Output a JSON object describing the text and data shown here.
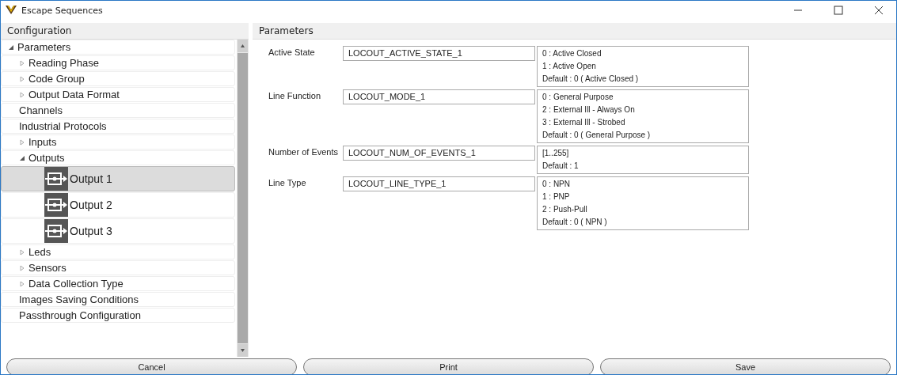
{
  "window": {
    "title": "Escape Sequences"
  },
  "sidebar": {
    "header": "Configuration",
    "tree": [
      {
        "label": "Parameters",
        "expanded": true,
        "children": [
          {
            "label": "Reading Phase",
            "expanded": false
          },
          {
            "label": "Code Group",
            "expanded": false
          },
          {
            "label": "Output Data Format",
            "expanded": false
          },
          {
            "label": "Channels"
          },
          {
            "label": "Industrial Protocols"
          },
          {
            "label": "Inputs",
            "expanded": false
          },
          {
            "label": "Outputs",
            "expanded": true,
            "children": [
              {
                "label": "Output 1",
                "kind": "output",
                "selected": true
              },
              {
                "label": "Output 2",
                "kind": "output",
                "selected": false
              },
              {
                "label": "Output 3",
                "kind": "output",
                "selected": false
              }
            ]
          },
          {
            "label": "Leds",
            "expanded": false
          },
          {
            "label": "Sensors",
            "expanded": false
          },
          {
            "label": "Data Collection Type",
            "expanded": false
          },
          {
            "label": "Images Saving Conditions"
          },
          {
            "label": "Passthrough Configuration"
          }
        ]
      }
    ]
  },
  "panel": {
    "header": "Parameters",
    "params": [
      {
        "label": "Active State",
        "value": "LOCOUT_ACTIVE_STATE_1",
        "info": [
          "0 :  Active Closed",
          "1 :  Active Open",
          "Default :  0  ( Active Closed )"
        ]
      },
      {
        "label": "Line Function",
        "value": "LOCOUT_MODE_1",
        "info": [
          "0 :  General Purpose",
          "2 :  External Ill - Always On",
          "3 :  External Ill - Strobed",
          "Default :  0  ( General Purpose )"
        ]
      },
      {
        "label": "Number of Events",
        "value": "LOCOUT_NUM_OF_EVENTS_1",
        "info": [
          "[1..255]",
          "Default :  1"
        ]
      },
      {
        "label": "Line Type",
        "value": "LOCOUT_LINE_TYPE_1",
        "info": [
          "0 :  NPN",
          "1 :  PNP",
          "2 :  Push-Pull",
          "Default :  0  ( NPN )"
        ]
      }
    ]
  },
  "buttons": [
    "Cancel",
    "Print",
    "Save"
  ]
}
